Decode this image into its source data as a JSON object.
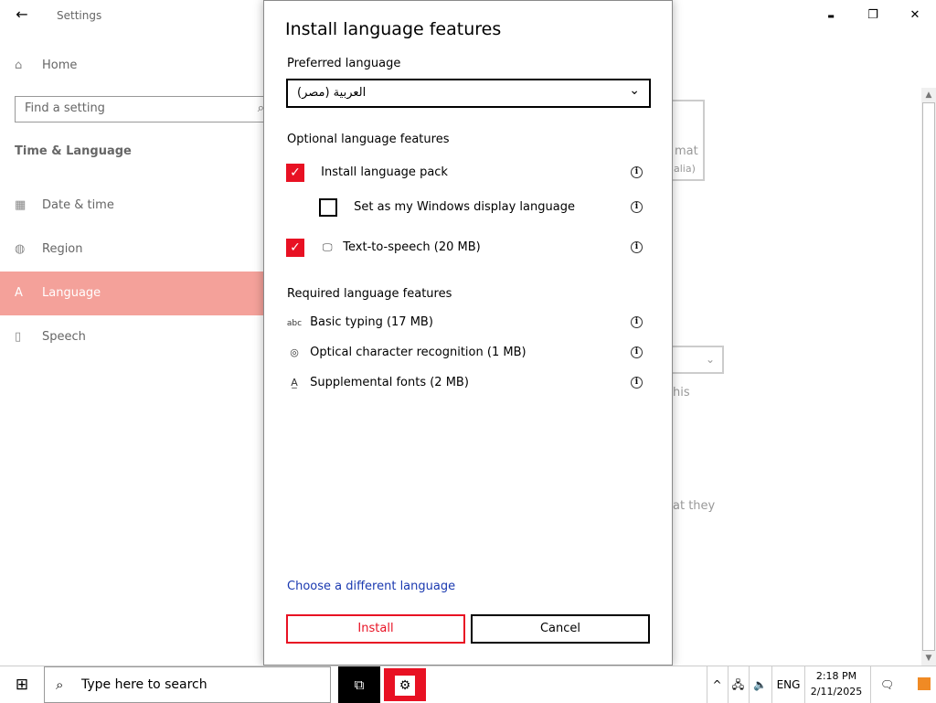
{
  "window": {
    "title": "Settings",
    "back": "←",
    "minimize": "▬",
    "restore": "❐",
    "close": "✕"
  },
  "sidebar": {
    "home": {
      "label": "Home",
      "icon": "⌂"
    },
    "search_placeholder": "Find a setting",
    "search_icon": "⌕",
    "section": "Time & Language",
    "items": [
      {
        "label": "Date & time",
        "icon": "▦"
      },
      {
        "label": "Region",
        "icon": "◍"
      },
      {
        "label": "Language",
        "icon": "A"
      },
      {
        "label": "Speech",
        "icon": "▯"
      }
    ]
  },
  "background": {
    "fragments": [
      "mat",
      "alia)",
      "his",
      "at they"
    ],
    "scroll_up": "▲",
    "scroll_down": "▼",
    "chevron": "⌄"
  },
  "dialog": {
    "title": "Install language features",
    "preferred_label": "Preferred language",
    "preferred_value": "العربية (مصر)",
    "chevron": "⌄",
    "optional_label": "Optional language features",
    "optional": [
      {
        "label": "Install language pack",
        "checked": true,
        "mark": "✓"
      },
      {
        "label": "Set as my Windows display language",
        "checked": false,
        "mark": ""
      },
      {
        "label": "Text-to-speech (20 MB)",
        "checked": true,
        "mark": "✓",
        "icon": "🖵"
      }
    ],
    "info_glyph": "i",
    "required_label": "Required language features",
    "required": [
      {
        "label": "Basic typing (17 MB)",
        "icon": "abc"
      },
      {
        "label": "Optical character recognition (1 MB)",
        "icon": "◎"
      },
      {
        "label": "Supplemental fonts (2 MB)",
        "icon": "A̲"
      }
    ],
    "link": "Choose a different language",
    "install": "Install",
    "cancel": "Cancel"
  },
  "taskbar": {
    "start_icon": "⊞",
    "search_icon": "⌕",
    "search_text": "Type here to search",
    "taskview_icon": "⧉",
    "settings_icon": "⚙",
    "tray_chevron": "^",
    "network_icon": "🖧",
    "volume_icon": "🔈",
    "lang": "ENG",
    "time": "2:18 PM",
    "date": "2/11/2025",
    "notification_icon": "🗨"
  },
  "colors": {
    "accent": "#e81123",
    "active_nav": "#f4a19a",
    "link": "#1a39b0"
  }
}
